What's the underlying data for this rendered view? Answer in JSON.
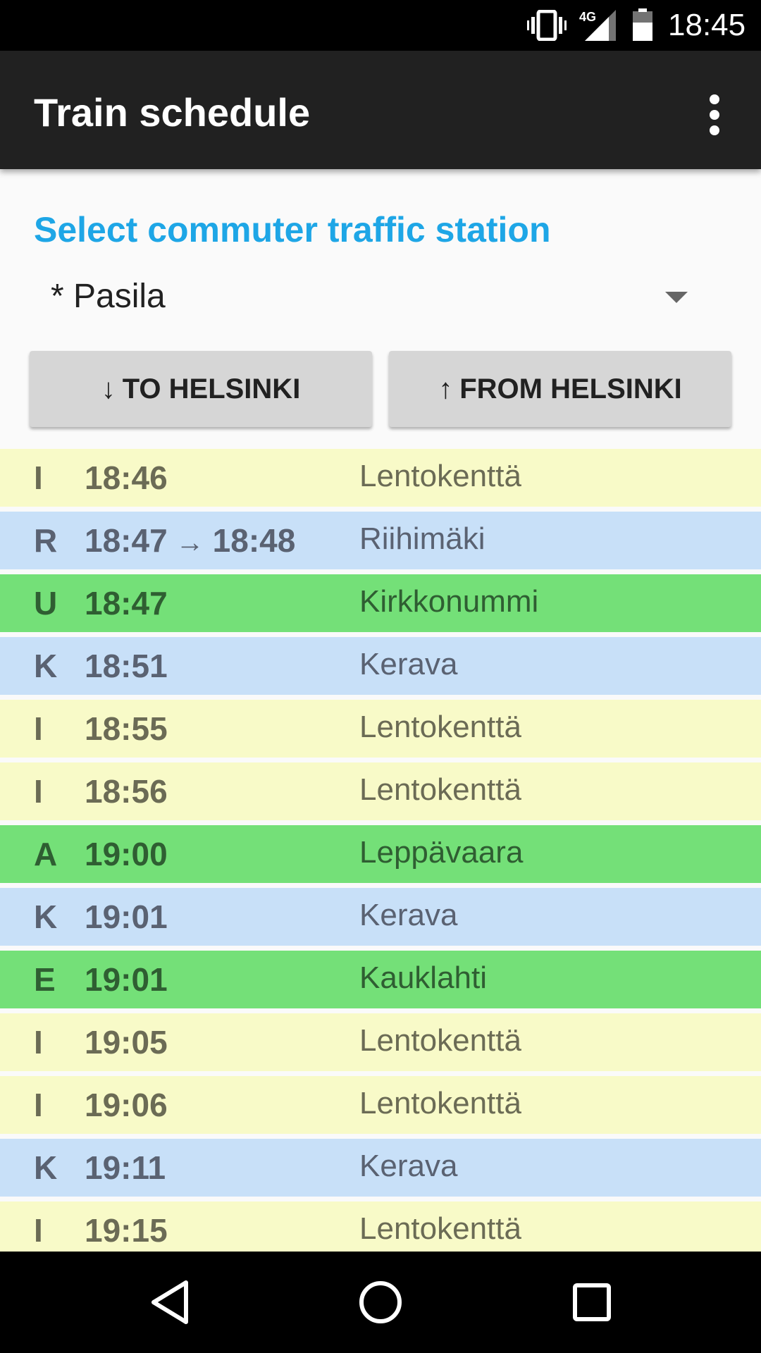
{
  "status_bar": {
    "network": "4G",
    "time": "18:45"
  },
  "app_bar": {
    "title": "Train schedule"
  },
  "station": {
    "label": "Select commuter traffic station",
    "selected": "* Pasila"
  },
  "buttons": {
    "to_arrow": "↓",
    "to_label": "TO HELSINKI",
    "from_arrow": "↑",
    "from_label": "FROM HELSINKI"
  },
  "colors": {
    "yellow": "#f8fac8",
    "blue": "#c8e0f8",
    "green": "#74e078",
    "accent": "#1ea6e6"
  },
  "schedule": [
    {
      "line": "I",
      "time": "18:46",
      "time_actual": "",
      "dest": "Lentokenttä",
      "color": "yellow"
    },
    {
      "line": "R",
      "time": "18:47",
      "time_actual": "18:48",
      "dest": "Riihimäki",
      "color": "blue"
    },
    {
      "line": "U",
      "time": "18:47",
      "time_actual": "",
      "dest": "Kirkkonummi",
      "color": "green"
    },
    {
      "line": "K",
      "time": "18:51",
      "time_actual": "",
      "dest": "Kerava",
      "color": "blue"
    },
    {
      "line": "I",
      "time": "18:55",
      "time_actual": "",
      "dest": "Lentokenttä",
      "color": "yellow"
    },
    {
      "line": "I",
      "time": "18:56",
      "time_actual": "",
      "dest": "Lentokenttä",
      "color": "yellow"
    },
    {
      "line": "A",
      "time": "19:00",
      "time_actual": "",
      "dest": "Leppävaara",
      "color": "green"
    },
    {
      "line": "K",
      "time": "19:01",
      "time_actual": "",
      "dest": "Kerava",
      "color": "blue"
    },
    {
      "line": "E",
      "time": "19:01",
      "time_actual": "",
      "dest": "Kauklahti",
      "color": "green"
    },
    {
      "line": "I",
      "time": "19:05",
      "time_actual": "",
      "dest": "Lentokenttä",
      "color": "yellow"
    },
    {
      "line": "I",
      "time": "19:06",
      "time_actual": "",
      "dest": "Lentokenttä",
      "color": "yellow"
    },
    {
      "line": "K",
      "time": "19:11",
      "time_actual": "",
      "dest": "Kerava",
      "color": "blue"
    },
    {
      "line": "I",
      "time": "19:15",
      "time_actual": "",
      "dest": "Lentokenttä",
      "color": "yellow"
    }
  ],
  "nav_bar": {
    "icons": [
      "back-icon",
      "home-icon",
      "recents-icon"
    ]
  }
}
